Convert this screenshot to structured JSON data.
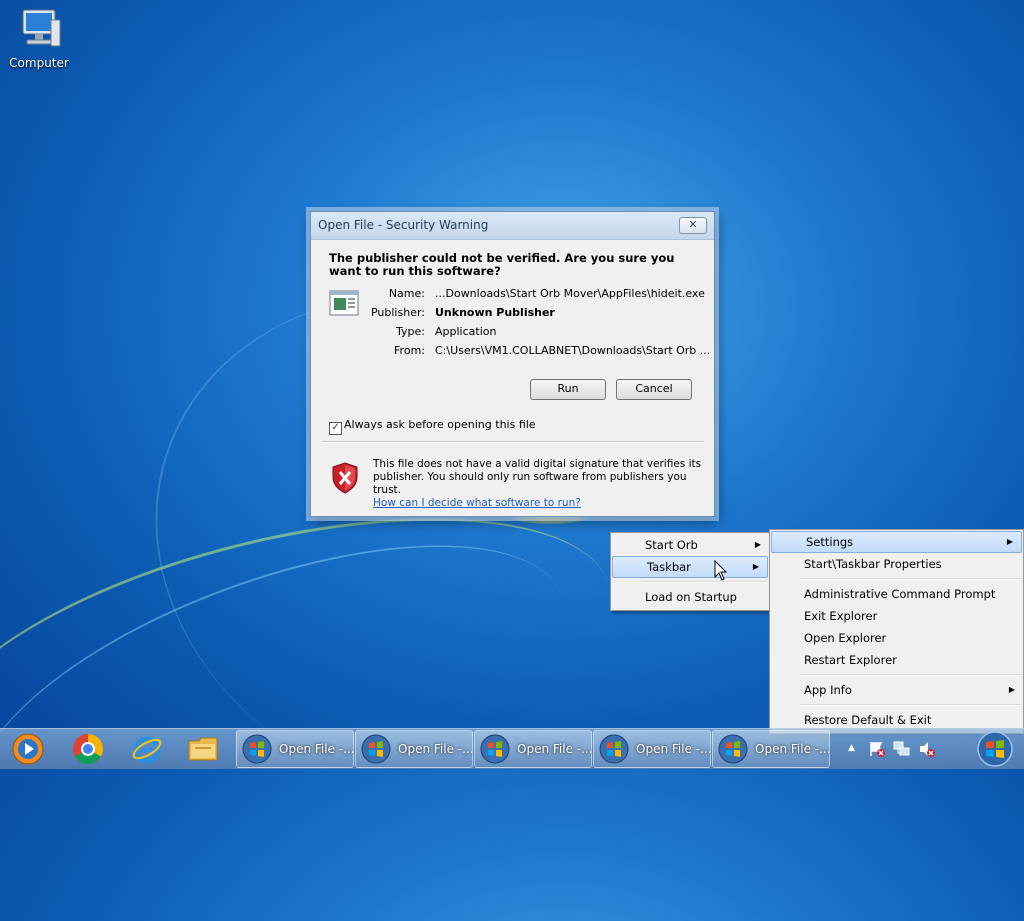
{
  "desktop": {
    "icons": [
      {
        "label": "Computer",
        "icon": "computer-icon"
      }
    ]
  },
  "dialog": {
    "title": "Open File - Security Warning",
    "close_glyph": "✕",
    "heading": "The publisher could not be verified.  Are you sure you want to run this software?",
    "fields": [
      {
        "label": "Name:",
        "value": "...Downloads\\Start Orb Mover\\AppFiles\\hideit.exe",
        "bold": false
      },
      {
        "label": "Publisher:",
        "value": "Unknown Publisher",
        "bold": true
      },
      {
        "label": "Type:",
        "value": "Application",
        "bold": false
      },
      {
        "label": "From:",
        "value": "C:\\Users\\VM1.COLLABNET\\Downloads\\Start Orb ...",
        "bold": false
      }
    ],
    "run_label": "Run",
    "cancel_label": "Cancel",
    "checkbox_label": "Always ask before opening this file",
    "checkbox_checked": true,
    "checkmark": "✓",
    "warning_text": "This file does not have a valid digital signature that verifies its publisher.  You should only run software from publishers you trust.",
    "warning_link": "How can I decide what software to run?"
  },
  "menu_main": {
    "items": [
      {
        "label": "Start Orb",
        "submenu": true
      },
      {
        "label": "Taskbar",
        "submenu": true,
        "highlighted": true
      },
      {
        "label": "Load on Startup",
        "submenu": false
      }
    ]
  },
  "menu_sub": {
    "items": [
      {
        "label": "Settings",
        "submenu": true,
        "highlighted": true
      },
      {
        "label": "Start\\Taskbar Properties"
      },
      {
        "label": "Administrative Command Prompt"
      },
      {
        "label": "Exit Explorer"
      },
      {
        "label": "Open Explorer"
      },
      {
        "label": "Restart Explorer"
      },
      {
        "label": "App Info",
        "submenu": true
      },
      {
        "label": "Restore Default & Exit"
      }
    ]
  },
  "taskbar": {
    "pinned": [
      "media-player-icon",
      "chrome-icon",
      "internet-explorer-icon",
      "file-explorer-icon"
    ],
    "tasks": [
      {
        "label": "Open File -..."
      },
      {
        "label": "Open File -..."
      },
      {
        "label": "Open File -..."
      },
      {
        "label": "Open File -..."
      },
      {
        "label": "Open File -..."
      }
    ],
    "tray_expand": "▲",
    "tray_icons": [
      "action-center-icon",
      "network-icon",
      "volume-muted-icon"
    ]
  },
  "colors": {
    "accent_blue": "#1e78cf",
    "link": "#1f5cc0",
    "shield_red": "#c8202a"
  }
}
